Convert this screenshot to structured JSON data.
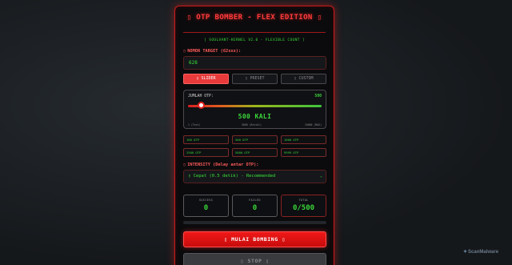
{
  "header": {
    "title": "OTP BOMBER - FLEX EDITION",
    "title_icon_left": "▯",
    "title_icon_right": "▯",
    "subtitle": "[ SOULVANT-KERNEL V2.0 - FLEXIBLE COUNT ]"
  },
  "target": {
    "icon": "▯",
    "label": "NOMOR TARGET (62xxx):",
    "value": "628"
  },
  "modes": [
    {
      "icon": "▯",
      "label": "SLIDER",
      "active": true
    },
    {
      "icon": "▯",
      "label": "PRESET",
      "active": false
    },
    {
      "icon": "▯",
      "label": "CUSTOM",
      "active": false
    }
  ],
  "slider": {
    "label": "JUMLAH OTP:",
    "value_display": "500",
    "count_display": "500 KALI",
    "min": 1,
    "max": 10000,
    "value": 500,
    "tick_min": "1 (Test)",
    "tick_mid": "5000 (Brutal)",
    "tick_max": "10000 (MAX)"
  },
  "presets": [
    "100 OTP",
    "500 OTP",
    "1000 OTP",
    "2500 OTP",
    "5000 OTP",
    "9999 OTP"
  ],
  "intensity": {
    "icon": "▯",
    "label": "INTENSITY (Delay antar OTP):",
    "selected": "▯ Cepat (0.5 detik) - Recommended",
    "chevron": "⌄"
  },
  "stats": {
    "success_label": "SUCCESS",
    "success_value": "0",
    "failed_label": "FAILED",
    "failed_value": "0",
    "total_label": "TOTAL",
    "total_value": "0/500"
  },
  "progress": {
    "fraction": 0
  },
  "buttons": {
    "start": "▯ MULAI BOMBING ▯",
    "stop": "▯ STOP ▯"
  },
  "watermark": {
    "icon": "✦",
    "text": "ScanMalware"
  },
  "colors": {
    "accent_red": "#e83a3a",
    "accent_green": "#39d639",
    "panel_bg": "#0b0b0d"
  }
}
